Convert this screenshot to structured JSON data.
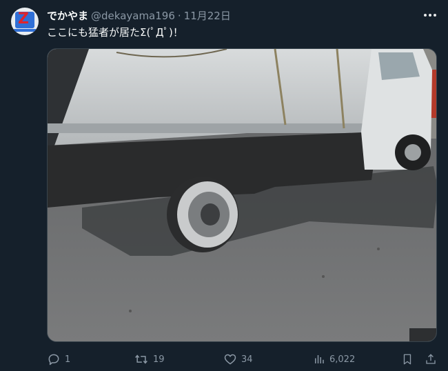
{
  "tweet": {
    "display_name": "でかやま",
    "handle": "@dekayama196",
    "separator": "·",
    "date": "11月22日",
    "text": "ここにも猛者が居たΣ(ﾟДﾟ)！"
  },
  "avatar": {
    "letter": "Z",
    "primary_color": "#2f6fd6",
    "letter_color": "#e0242b"
  },
  "media": {
    "icon": "photo"
  },
  "actions": {
    "reply_count": "1",
    "retweet_count": "19",
    "like_count": "34",
    "views_count": "6,022"
  },
  "icons": {
    "more": "more-horizontal-icon",
    "reply": "reply-icon",
    "retweet": "retweet-icon",
    "like": "heart-icon",
    "views": "bar-chart-icon",
    "bookmark": "bookmark-icon",
    "share": "share-icon"
  },
  "colors": {
    "background": "#15202b",
    "primary_text": "#f7f9f9",
    "secondary_text": "#8b98a5",
    "border": "#38444d"
  }
}
